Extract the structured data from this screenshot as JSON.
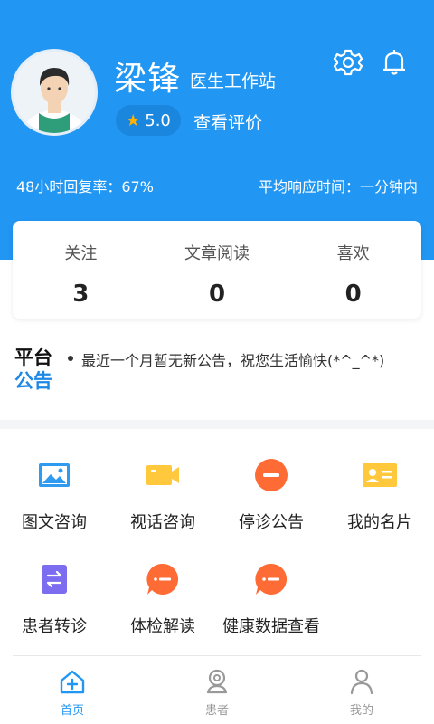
{
  "profile": {
    "name": "梁锋",
    "role": "医生工作站",
    "rating": "5.0",
    "view_reviews": "查看评价"
  },
  "header_icons": [
    "gear-icon",
    "bell-icon"
  ],
  "stats_line": {
    "reply_rate": "48小时回复率：67%",
    "avg_response": "平均响应时间：一分钟内"
  },
  "stats": [
    {
      "label": "关注",
      "value": "3"
    },
    {
      "label": "文章阅读",
      "value": "0"
    },
    {
      "label": "喜欢",
      "value": "0"
    }
  ],
  "notice": {
    "title_line1": "平台",
    "title_line2": "公告",
    "text": "最近一个月暂无新公告，祝您生活愉快(*^_^*)"
  },
  "menu": [
    {
      "label": "图文咨询",
      "icon": "image-icon"
    },
    {
      "label": "视话咨询",
      "icon": "video-icon"
    },
    {
      "label": "停诊公告",
      "icon": "minus-circle-icon"
    },
    {
      "label": "我的名片",
      "icon": "id-card-icon"
    },
    {
      "label": "患者转诊",
      "icon": "transfer-icon"
    },
    {
      "label": "体检解读",
      "icon": "chat-bubble-icon"
    },
    {
      "label": "健康数据查看",
      "icon": "chat-bubble-icon"
    }
  ],
  "tabs": [
    {
      "label": "首页",
      "icon": "home-icon",
      "active": true
    },
    {
      "label": "患者",
      "icon": "patient-icon",
      "active": false
    },
    {
      "label": "我的",
      "icon": "user-icon",
      "active": false
    }
  ],
  "colors": {
    "primary": "#2196f3",
    "star": "#ffb300",
    "orange": "#ff6b35",
    "yellow": "#ffc83d",
    "purple": "#7b6cf0"
  }
}
